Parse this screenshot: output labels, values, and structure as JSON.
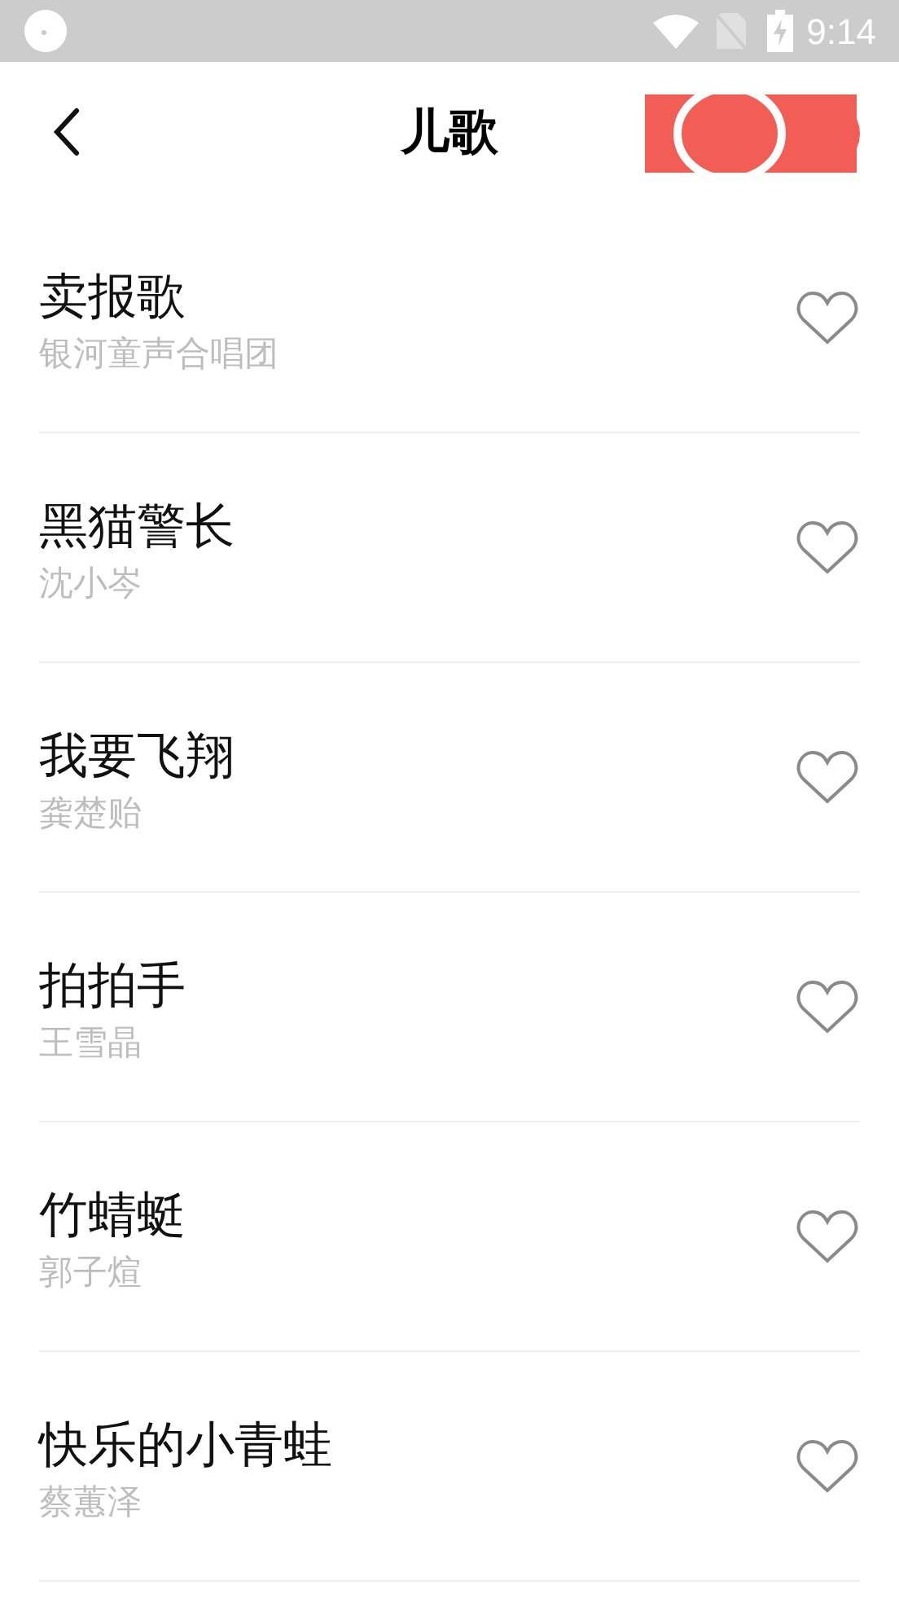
{
  "status_bar": {
    "time": "9:14"
  },
  "header": {
    "title": "儿歌"
  },
  "songs": [
    {
      "title": "卖报歌",
      "artist": "银河童声合唱团",
      "favorited": false
    },
    {
      "title": "黑猫警长",
      "artist": "沈小岑",
      "favorited": false
    },
    {
      "title": "我要飞翔",
      "artist": "龚楚贻",
      "favorited": false
    },
    {
      "title": "拍拍手",
      "artist": "王雪晶",
      "favorited": false
    },
    {
      "title": "竹蜻蜓",
      "artist": "郭子煊",
      "favorited": false
    },
    {
      "title": "快乐的小青蛙",
      "artist": "蔡蕙泽",
      "favorited": false
    }
  ]
}
